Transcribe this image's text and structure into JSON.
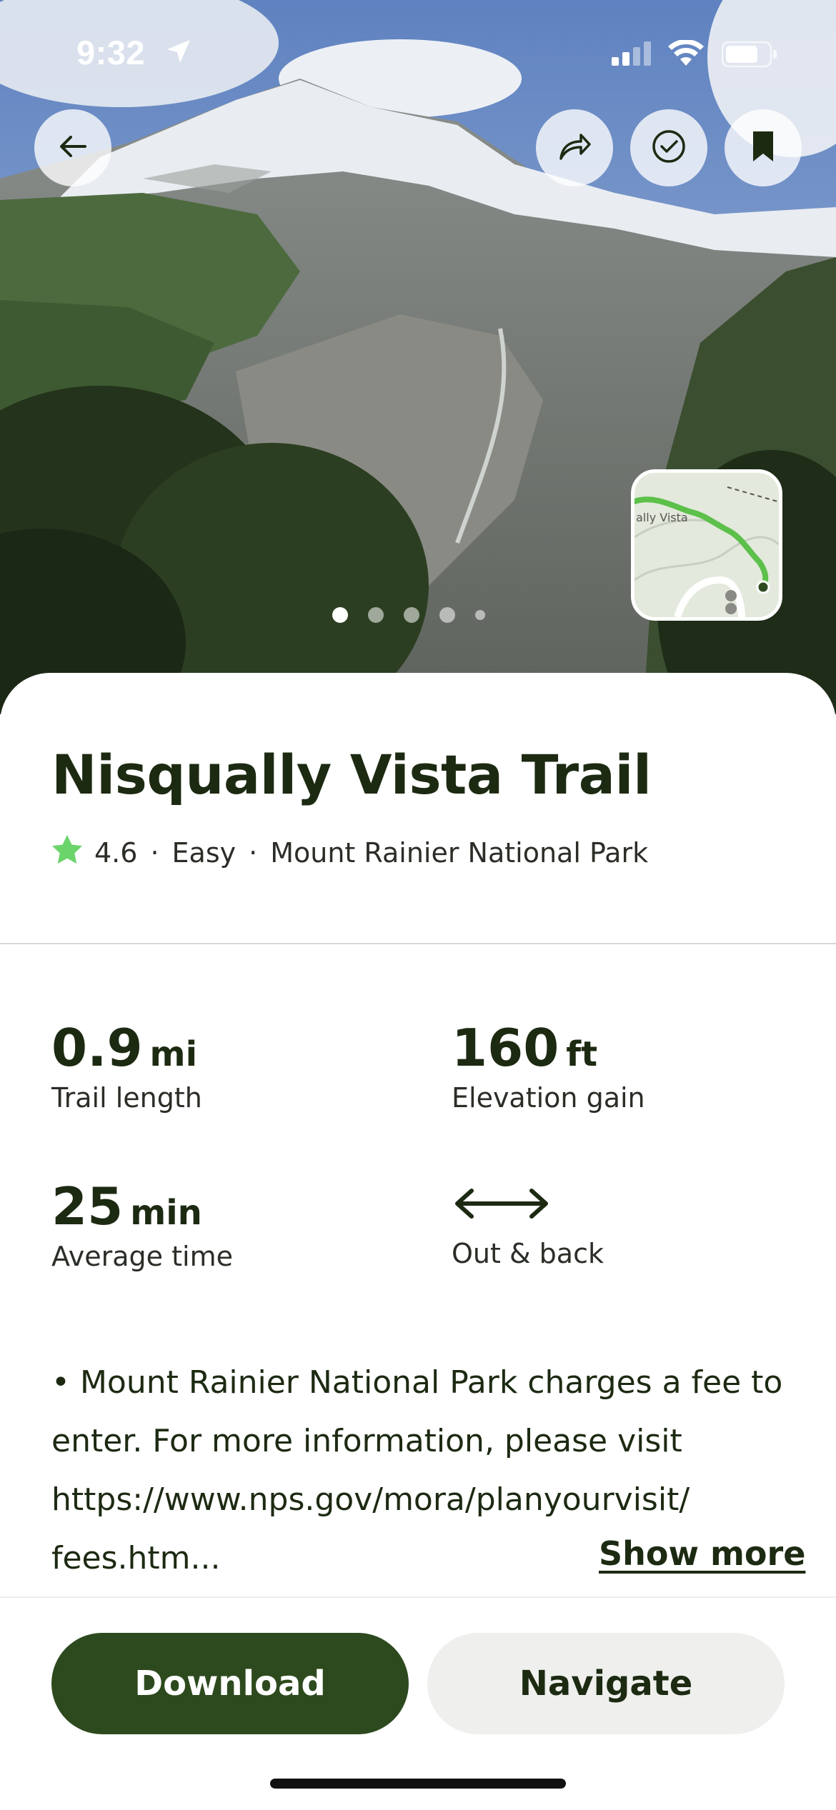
{
  "status_bar": {
    "time": "9:32",
    "icons": [
      "location-arrow-icon",
      "cellular-signal-icon",
      "wifi-icon",
      "battery-icon"
    ]
  },
  "hero": {
    "image_subject": "mountain-photo",
    "gallery_dots_count": 5,
    "active_dot_index": 0,
    "buttons": {
      "back": "back-arrow-icon",
      "share": "share-icon",
      "complete": "checkmark-circle-icon",
      "save": "bookmark-icon"
    },
    "map_thumbnail": {
      "label": "ally Vista",
      "route_color": "#5cc04a"
    }
  },
  "trail": {
    "name": "Nisqually Vista Trail",
    "rating": "4.6",
    "difficulty": "Easy",
    "park": "Mount Rainier National Park",
    "separator": "·",
    "star_color": "#6bd46b"
  },
  "stats": {
    "length": {
      "value": "0.9",
      "unit": "mi",
      "label": "Trail length"
    },
    "elevation": {
      "value": "160",
      "unit": "ft",
      "label": "Elevation gain"
    },
    "time": {
      "value": "25",
      "unit": "min",
      "label": "Average time"
    },
    "route_type": {
      "icon": "double-arrow-icon",
      "label": "Out & back"
    }
  },
  "description": {
    "text": "• Mount Rainier National Park charges a fee to enter. For more information, please visit https://www.nps.gov/mora/planyourvisit/ fees.htm...",
    "show_more_label": "Show more"
  },
  "actions": {
    "download_label": "Download",
    "navigate_label": "Navigate"
  },
  "colors": {
    "brand_dark_green": "#2d4a1e",
    "text_dark": "#1d2a12",
    "secondary_button_bg": "#efefed"
  }
}
